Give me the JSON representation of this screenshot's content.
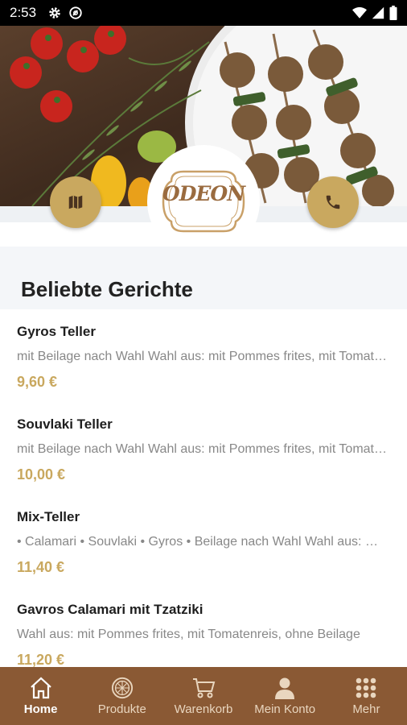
{
  "status_bar": {
    "time": "2:53",
    "left_icons": [
      "gear-icon",
      "at-icon"
    ],
    "right_icons": [
      "wifi-icon",
      "signal-icon",
      "battery-icon"
    ]
  },
  "header": {
    "logo_text": "ODEON",
    "map_button_icon": "map-icon",
    "phone_button_icon": "phone-icon"
  },
  "section": {
    "title": "Beliebte Gerichte"
  },
  "items": [
    {
      "name": "Gyros Teller",
      "description": "mit Beilage nach Wahl Wahl aus: mit Pommes frites, mit Tomatenreis, ohne Beilage",
      "price": "9,60 €"
    },
    {
      "name": "Souvlaki Teller",
      "description": "mit Beilage nach Wahl Wahl aus: mit Pommes frites, mit Tomatenreis, ohne Beilage",
      "price": "10,00 €"
    },
    {
      "name": "Mix-Teller",
      "description": "• Calamari • Souvlaki • Gyros • Beilage nach Wahl Wahl aus: mit Pommes frites",
      "price": "11,40 €"
    },
    {
      "name": "Gavros Calamari mit Tzatziki",
      "description": "Wahl aus: mit Pommes frites, mit Tomatenreis, ohne Beilage",
      "price": "11,20 €"
    }
  ],
  "bottom_nav": [
    {
      "label": "Home",
      "icon": "home-icon",
      "active": true
    },
    {
      "label": "Produkte",
      "icon": "pizza-icon",
      "active": false
    },
    {
      "label": "Warenkorb",
      "icon": "cart-icon",
      "active": false
    },
    {
      "label": "Mein Konto",
      "icon": "user-icon",
      "active": false
    },
    {
      "label": "Mehr",
      "icon": "grid-icon",
      "active": false
    }
  ],
  "colors": {
    "accent_gold": "#c9a85f",
    "nav_brown": "#8a5934",
    "section_bg": "#f4f6f9"
  }
}
